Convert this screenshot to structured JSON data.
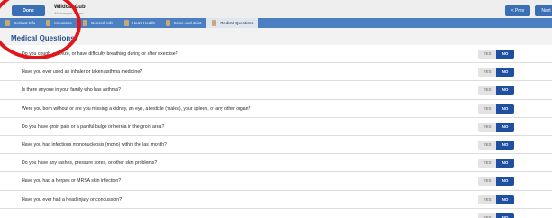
{
  "header": {
    "done_label": "Done",
    "title": "Wildcat Cub",
    "subtitle": "All changes saved",
    "prev_label": "< Prev",
    "next_label": "Next"
  },
  "tabs": [
    {
      "label": "Contact Info",
      "active": false
    },
    {
      "label": "Insurance",
      "active": false
    },
    {
      "label": "General Info",
      "active": false
    },
    {
      "label": "Heart Health",
      "active": false
    },
    {
      "label": "Bone And Joint",
      "active": false
    },
    {
      "label": "Medical Questions",
      "active": true
    }
  ],
  "section": {
    "title": "Medical Questions"
  },
  "toggle": {
    "yes_label": "YES",
    "no_label": "NO"
  },
  "questions": [
    {
      "text": "Do you cough, wheeze, or have difficulty breathing during or after exercise?",
      "answer": "NO"
    },
    {
      "text": "Have you ever used an inhaler or taken asthma medicine?",
      "answer": "NO"
    },
    {
      "text": "Is there anyone in your family who has asthma?",
      "answer": "NO"
    },
    {
      "text": "Were you born without or are you missing a kidney, an eye, a testicle (males), your spleen, or any other organ?",
      "answer": "NO"
    },
    {
      "text": "Do you have groin pain or a painful bulge or hernia in the groin area?",
      "answer": "NO"
    },
    {
      "text": "Have you had infectious mononucleosis (mono) within the last month?",
      "answer": "NO"
    },
    {
      "text": "Do you have any rashes, pressure sores, or other skin problems?",
      "answer": "NO"
    },
    {
      "text": "Have you had a herpes or MRSA skin infection?",
      "answer": "NO"
    },
    {
      "text": "Have you ever had a head injury or concussion?",
      "answer": "NO"
    },
    {
      "text": "",
      "answer": "NO"
    }
  ],
  "colors": {
    "primary": "#3b6fb5",
    "tab_bar": "#4a7fc1",
    "selected_no": "#1e4fa0",
    "annotation": "#e3151b"
  }
}
